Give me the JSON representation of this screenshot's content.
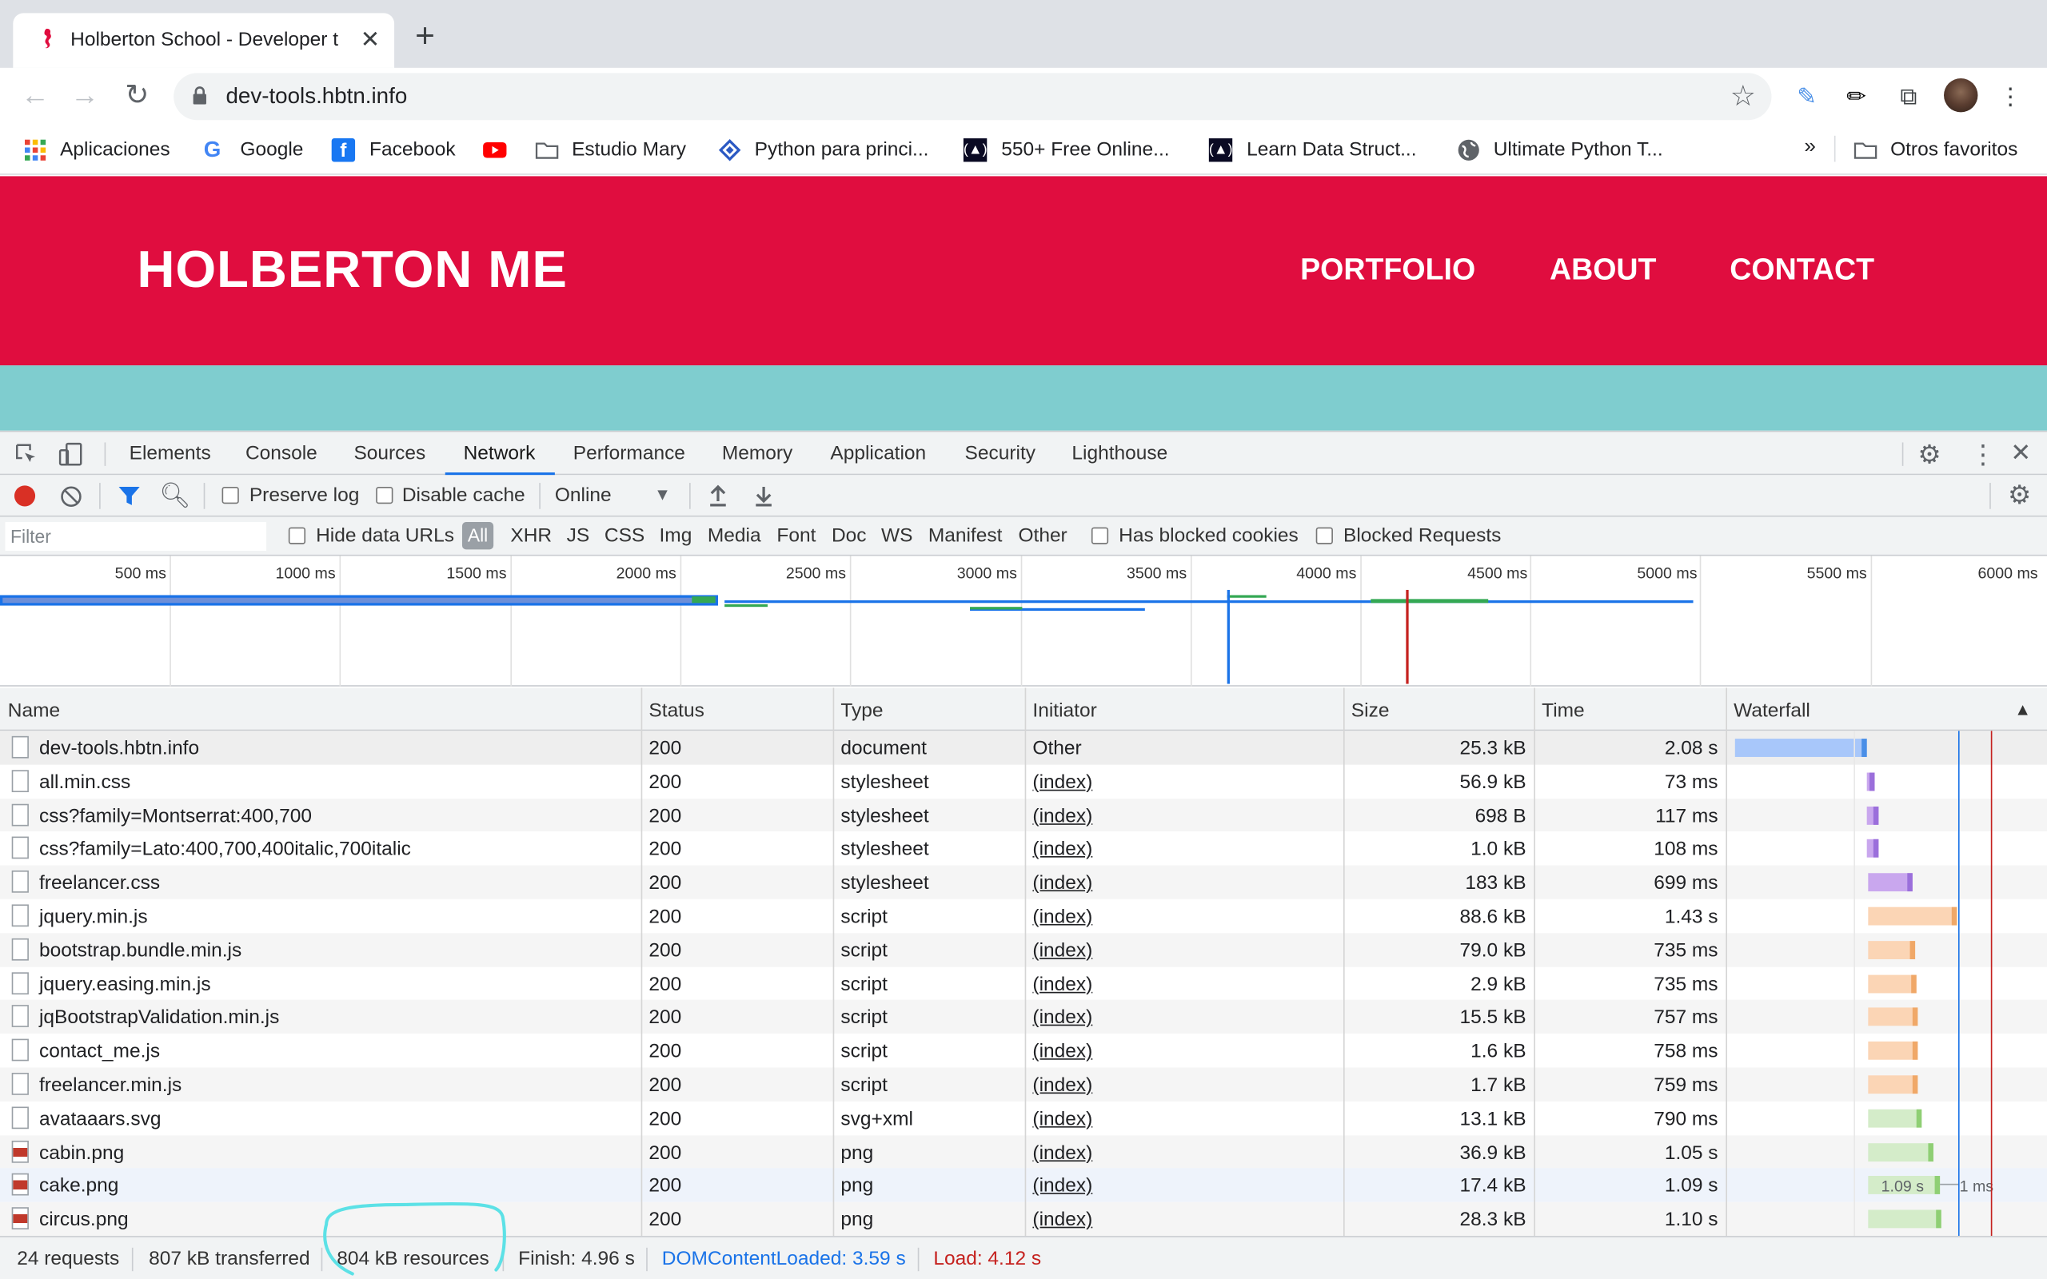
{
  "browser": {
    "tab_title": "Holberton School - Developer t",
    "url": "dev-tools.hbtn.info",
    "bookmarks": [
      "Aplicaciones",
      "Google",
      "Facebook",
      "Estudio Mary",
      "Python para princi...",
      "550+ Free Online...",
      "Learn Data Struct...",
      "Ultimate Python T...",
      "Otros favoritos"
    ],
    "overflow": "»"
  },
  "site": {
    "brand": "HOLBERTON ME",
    "nav": [
      "PORTFOLIO",
      "ABOUT",
      "CONTACT"
    ],
    "brand_color": "#e00d3f",
    "band_color": "#7fcdcf"
  },
  "devtools": {
    "tabs": [
      "Elements",
      "Console",
      "Sources",
      "Network",
      "Performance",
      "Memory",
      "Application",
      "Security",
      "Lighthouse"
    ],
    "active_tab": "Network",
    "toolbar": {
      "preserve_log": "Preserve log",
      "disable_cache": "Disable cache",
      "throttle": "Online"
    },
    "filter": {
      "placeholder": "Filter",
      "hide_data_urls": "Hide data URLs",
      "types": [
        "All",
        "XHR",
        "JS",
        "CSS",
        "Img",
        "Media",
        "Font",
        "Doc",
        "WS",
        "Manifest",
        "Other"
      ],
      "has_blocked_cookies": "Has blocked cookies",
      "blocked_requests": "Blocked Requests"
    },
    "timeline_ticks": [
      "500 ms",
      "1000 ms",
      "1500 ms",
      "2000 ms",
      "2500 ms",
      "3000 ms",
      "3500 ms",
      "4000 ms",
      "4500 ms",
      "5000 ms",
      "5500 ms",
      "6000 ms"
    ],
    "columns": [
      "Name",
      "Status",
      "Type",
      "Initiator",
      "Size",
      "Time",
      "Waterfall"
    ],
    "rows": [
      {
        "name": "dev-tools.hbtn.info",
        "status": "200",
        "type": "document",
        "initiator": "Other",
        "size": "25.3 kB",
        "time": "2.08 s"
      },
      {
        "name": "all.min.css",
        "status": "200",
        "type": "stylesheet",
        "initiator": "(index)",
        "size": "56.9 kB",
        "time": "73 ms"
      },
      {
        "name": "css?family=Montserrat:400,700",
        "status": "200",
        "type": "stylesheet",
        "initiator": "(index)",
        "size": "698 B",
        "time": "117 ms"
      },
      {
        "name": "css?family=Lato:400,700,400italic,700italic",
        "status": "200",
        "type": "stylesheet",
        "initiator": "(index)",
        "size": "1.0 kB",
        "time": "108 ms"
      },
      {
        "name": "freelancer.css",
        "status": "200",
        "type": "stylesheet",
        "initiator": "(index)",
        "size": "183 kB",
        "time": "699 ms"
      },
      {
        "name": "jquery.min.js",
        "status": "200",
        "type": "script",
        "initiator": "(index)",
        "size": "88.6 kB",
        "time": "1.43 s"
      },
      {
        "name": "bootstrap.bundle.min.js",
        "status": "200",
        "type": "script",
        "initiator": "(index)",
        "size": "79.0 kB",
        "time": "735 ms"
      },
      {
        "name": "jquery.easing.min.js",
        "status": "200",
        "type": "script",
        "initiator": "(index)",
        "size": "2.9 kB",
        "time": "735 ms"
      },
      {
        "name": "jqBootstrapValidation.min.js",
        "status": "200",
        "type": "script",
        "initiator": "(index)",
        "size": "15.5 kB",
        "time": "757 ms"
      },
      {
        "name": "contact_me.js",
        "status": "200",
        "type": "script",
        "initiator": "(index)",
        "size": "1.6 kB",
        "time": "758 ms"
      },
      {
        "name": "freelancer.min.js",
        "status": "200",
        "type": "script",
        "initiator": "(index)",
        "size": "1.7 kB",
        "time": "759 ms"
      },
      {
        "name": "avataaars.svg",
        "status": "200",
        "type": "svg+xml",
        "initiator": "(index)",
        "size": "13.1 kB",
        "time": "790 ms"
      },
      {
        "name": "cabin.png",
        "status": "200",
        "type": "png",
        "initiator": "(index)",
        "size": "36.9 kB",
        "time": "1.05 s"
      },
      {
        "name": "cake.png",
        "status": "200",
        "type": "png",
        "initiator": "(index)",
        "size": "17.4 kB",
        "time": "1.09 s"
      },
      {
        "name": "circus.png",
        "status": "200",
        "type": "png",
        "initiator": "(index)",
        "size": "28.3 kB",
        "time": "1.10 s"
      }
    ],
    "waterfall_tooltip": {
      "left": "1.09 s",
      "right": "1 ms"
    },
    "summary": {
      "requests": "24 requests",
      "transferred": "807 kB transferred",
      "resources": "804 kB resources",
      "finish": "Finish: 4.96 s",
      "dcl": "DOMContentLoaded: 3.59 s",
      "load": "Load: 4.12 s"
    },
    "colors": {
      "dcl": "#1a73e8",
      "load": "#c5221f",
      "annotation": "#5ce1e6"
    }
  }
}
